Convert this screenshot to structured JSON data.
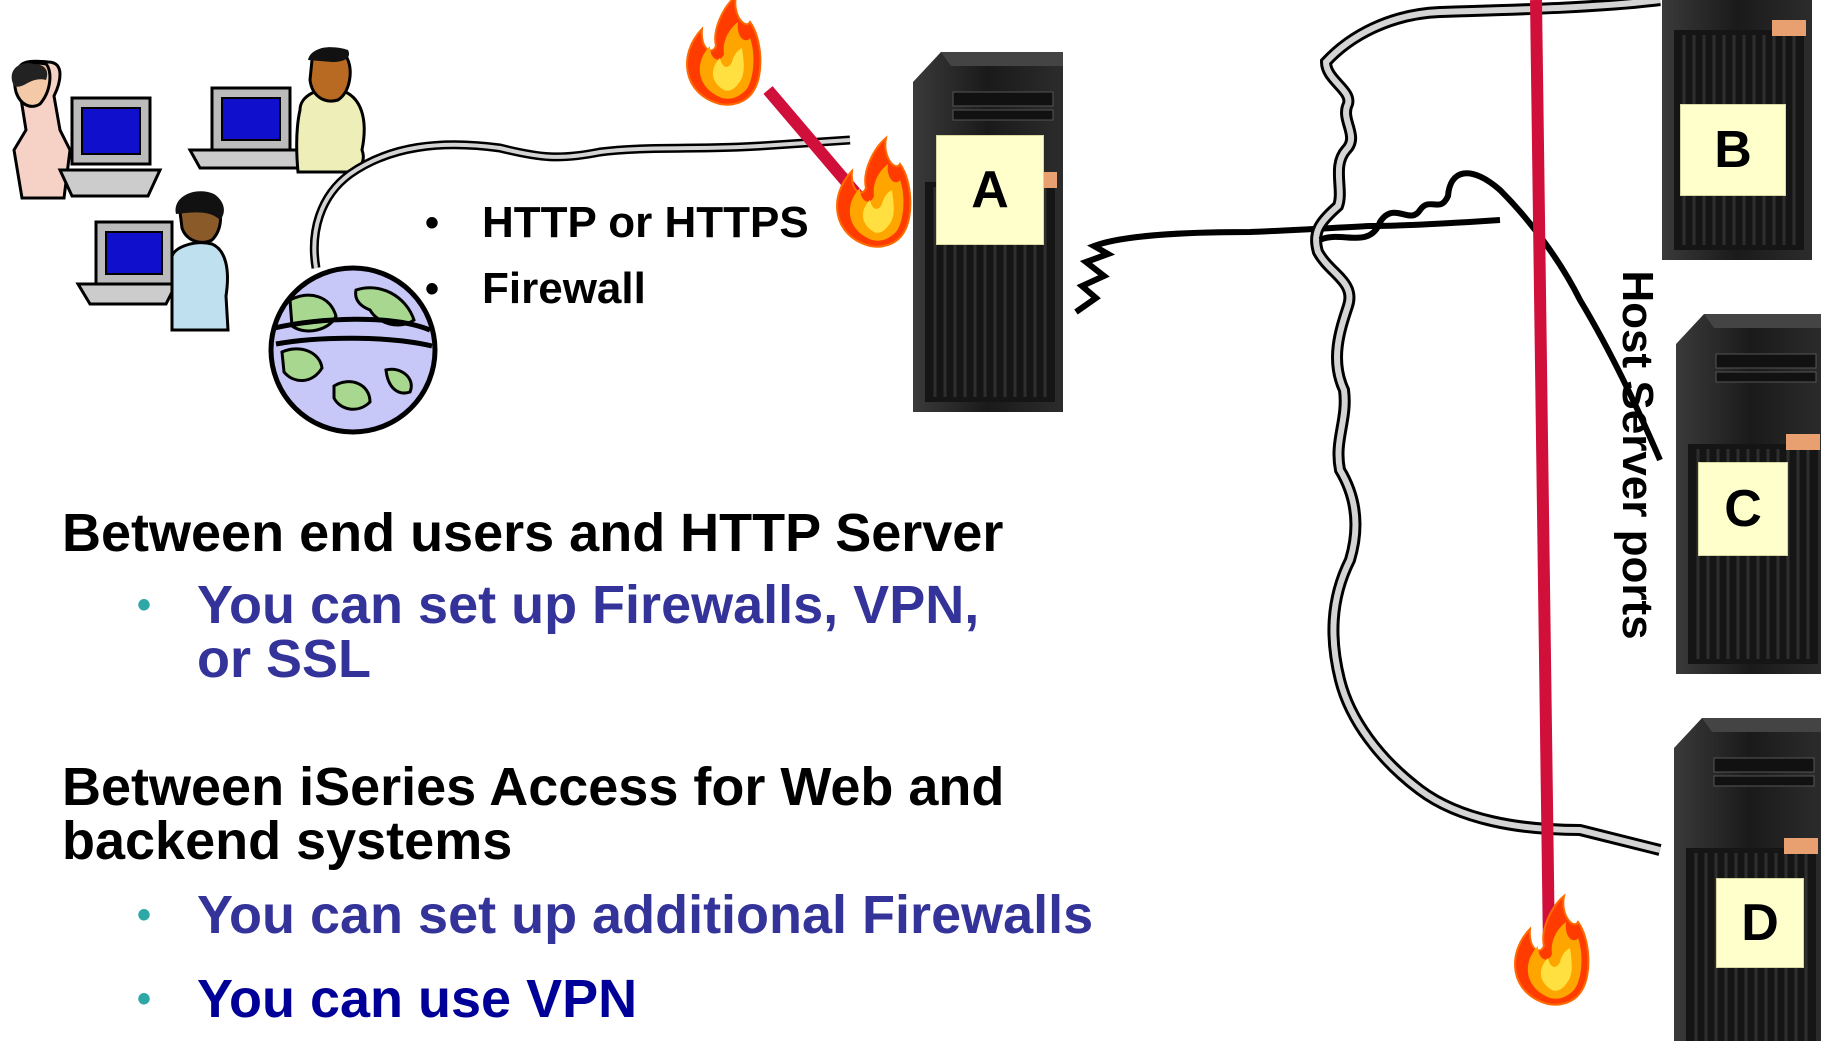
{
  "protocols": {
    "items": [
      "HTTP or HTTPS",
      "Firewall"
    ]
  },
  "servers": {
    "a": "A",
    "b": "B",
    "c": "C",
    "d": "D"
  },
  "host_ports_label": "Host Server ports",
  "section1": {
    "heading": "Between end users and HTTP Server",
    "bullets": [
      "You can set up Firewalls, VPN, or SSL"
    ]
  },
  "section2": {
    "heading_line1": "Between iSeries Access for Web and",
    "heading_line2": "backend systems",
    "bullets": [
      "You can set up additional Firewalls",
      "You can use VPN"
    ]
  },
  "colors": {
    "bullet_text": "#333399",
    "bullet_text_dark": "#000099",
    "bullet_marker": "#2ea7a7",
    "firewall_line": "#d0103a",
    "label_fill": "#ffffcc",
    "server_body": "#1e1e1e",
    "cable_fill": "#d4d4d4"
  },
  "icons": [
    "users-group-icon",
    "globe-icon",
    "fire-icon",
    "server-tower-icon"
  ]
}
